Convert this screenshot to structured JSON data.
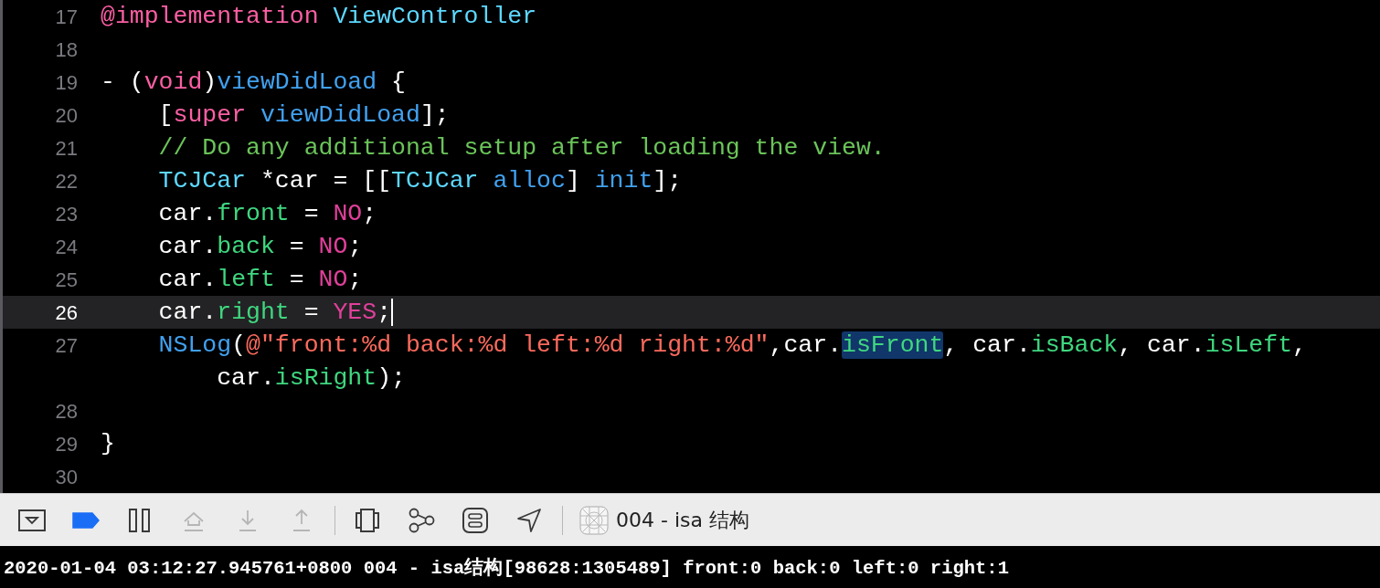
{
  "editor": {
    "lines": [
      {
        "number": "17",
        "current": false,
        "rows": [
          {
            "tokens": [
              {
                "kind": "keyword",
                "text": "@implementation"
              },
              {
                "kind": "class",
                "text": " ViewController"
              }
            ]
          }
        ]
      },
      {
        "number": "18",
        "current": false,
        "rows": [
          {
            "tokens": []
          }
        ]
      },
      {
        "number": "19",
        "current": false,
        "rows": [
          {
            "tokens": [
              {
                "kind": "plain",
                "text": "- ("
              },
              {
                "kind": "keyword",
                "text": "void"
              },
              {
                "kind": "plain",
                "text": ")"
              },
              {
                "kind": "decl",
                "text": "viewDidLoad"
              },
              {
                "kind": "plain",
                "text": " {"
              }
            ]
          }
        ]
      },
      {
        "number": "20",
        "current": false,
        "rows": [
          {
            "tokens": [
              {
                "kind": "plain",
                "text": "    ["
              },
              {
                "kind": "keyword",
                "text": "super"
              },
              {
                "kind": "method",
                "text": " viewDidLoad"
              },
              {
                "kind": "plain",
                "text": "];"
              }
            ]
          }
        ]
      },
      {
        "number": "21",
        "current": false,
        "rows": [
          {
            "tokens": [
              {
                "kind": "comment",
                "text": "    // Do any additional setup after loading the view."
              }
            ]
          }
        ]
      },
      {
        "number": "22",
        "current": false,
        "rows": [
          {
            "tokens": [
              {
                "kind": "class",
                "text": "    TCJCar"
              },
              {
                "kind": "plain",
                "text": " *car = [["
              },
              {
                "kind": "class",
                "text": "TCJCar"
              },
              {
                "kind": "method",
                "text": " alloc"
              },
              {
                "kind": "plain",
                "text": "] "
              },
              {
                "kind": "method",
                "text": "init"
              },
              {
                "kind": "plain",
                "text": "];"
              }
            ]
          }
        ]
      },
      {
        "number": "23",
        "current": false,
        "rows": [
          {
            "tokens": [
              {
                "kind": "plain",
                "text": "    car."
              },
              {
                "kind": "property",
                "text": "front"
              },
              {
                "kind": "plain",
                "text": " = "
              },
              {
                "kind": "literal",
                "text": "NO"
              },
              {
                "kind": "plain",
                "text": ";"
              }
            ]
          }
        ]
      },
      {
        "number": "24",
        "current": false,
        "rows": [
          {
            "tokens": [
              {
                "kind": "plain",
                "text": "    car."
              },
              {
                "kind": "property",
                "text": "back"
              },
              {
                "kind": "plain",
                "text": " = "
              },
              {
                "kind": "literal",
                "text": "NO"
              },
              {
                "kind": "plain",
                "text": ";"
              }
            ]
          }
        ]
      },
      {
        "number": "25",
        "current": false,
        "rows": [
          {
            "tokens": [
              {
                "kind": "plain",
                "text": "    car."
              },
              {
                "kind": "property",
                "text": "left"
              },
              {
                "kind": "plain",
                "text": " = "
              },
              {
                "kind": "literal",
                "text": "NO"
              },
              {
                "kind": "plain",
                "text": ";"
              }
            ]
          }
        ]
      },
      {
        "number": "26",
        "current": true,
        "rows": [
          {
            "tokens": [
              {
                "kind": "plain",
                "text": "    car."
              },
              {
                "kind": "property",
                "text": "right"
              },
              {
                "kind": "plain",
                "text": " = "
              },
              {
                "kind": "literal",
                "text": "YES"
              },
              {
                "kind": "plain",
                "text": ";"
              }
            ]
          }
        ]
      },
      {
        "number": "27",
        "current": false,
        "rows": [
          {
            "tokens": [
              {
                "kind": "function",
                "text": "    NSLog"
              },
              {
                "kind": "plain",
                "text": "("
              },
              {
                "kind": "string",
                "text": "@\"front:%d back:%d left:%d right:%d\""
              },
              {
                "kind": "plain",
                "text": ",car."
              },
              {
                "kind": "property",
                "text": "isFront",
                "highlighted": true
              },
              {
                "kind": "plain",
                "text": ", car."
              },
              {
                "kind": "property",
                "text": "isBack"
              },
              {
                "kind": "plain",
                "text": ", car."
              },
              {
                "kind": "property",
                "text": "isLeft"
              },
              {
                "kind": "plain",
                "text": ","
              }
            ]
          },
          {
            "tokens": [
              {
                "kind": "plain",
                "text": "        car."
              },
              {
                "kind": "property",
                "text": "isRight"
              },
              {
                "kind": "plain",
                "text": ");"
              }
            ]
          }
        ]
      },
      {
        "number": "28",
        "current": false,
        "rows": [
          {
            "tokens": []
          }
        ]
      },
      {
        "number": "29",
        "current": false,
        "rows": [
          {
            "tokens": [
              {
                "kind": "plain",
                "text": "}"
              }
            ]
          }
        ]
      },
      {
        "number": "30",
        "current": false,
        "rows": [
          {
            "tokens": []
          }
        ]
      }
    ]
  },
  "debug_bar": {
    "buttons": [
      {
        "kind": "hide-area",
        "disabled": false
      },
      {
        "kind": "breakpoints",
        "disabled": false,
        "on": true
      },
      {
        "kind": "pause",
        "disabled": false
      },
      {
        "kind": "step-over",
        "disabled": true
      },
      {
        "kind": "step-into",
        "disabled": true
      },
      {
        "kind": "step-out",
        "disabled": true
      },
      {
        "kind": "divider"
      },
      {
        "kind": "view-debug",
        "disabled": false
      },
      {
        "kind": "memory-graph",
        "disabled": false
      },
      {
        "kind": "environment",
        "disabled": false
      },
      {
        "kind": "location",
        "disabled": false
      },
      {
        "kind": "divider"
      }
    ],
    "target": "004 - isa 结构"
  },
  "console": {
    "output": "2020-01-04 03:12:27.945761+0800 004 - isa结构[98628:1305489] front:0 back:0 left:0 right:1"
  }
}
